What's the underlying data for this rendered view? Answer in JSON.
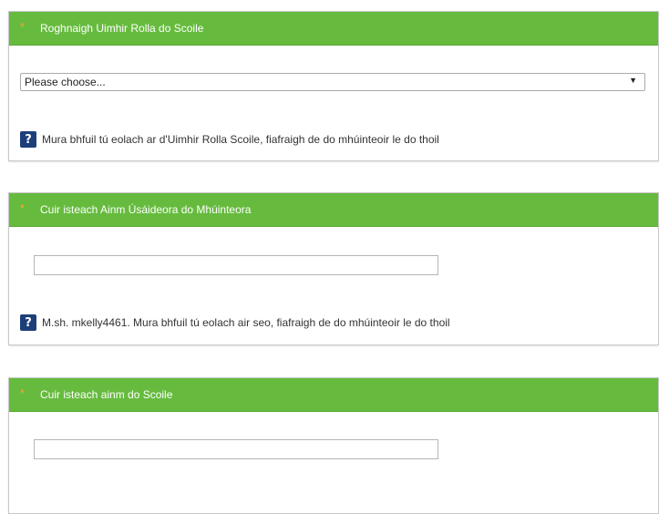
{
  "panels": [
    {
      "header": "Roghnaigh Uimhir Rolla do Scoile",
      "select_value": "Please choose...",
      "hint": "Mura bhfuil tú eolach ar d'Uimhir Rolla Scoile, fiafraigh de do mhúinteoir le do thoil"
    },
    {
      "header": "Cuir isteach Ainm Úsáideora do Mhúinteora",
      "input_value": "",
      "hint": "M.sh. mkelly4461. Mura bhfuil tú eolach air seo, fiafraigh de do mhúinteoir le do thoil"
    },
    {
      "header": "Cuir isteach ainm do Scoile",
      "input_value": ""
    }
  ],
  "required_marker": "*",
  "help_glyph": "?",
  "icons": {
    "help": "help-question-icon",
    "dropdown": "chevron-down-icon"
  },
  "colors": {
    "header": "#66bb3e",
    "required": "#f2a43a",
    "help": "#1c3f7a"
  }
}
